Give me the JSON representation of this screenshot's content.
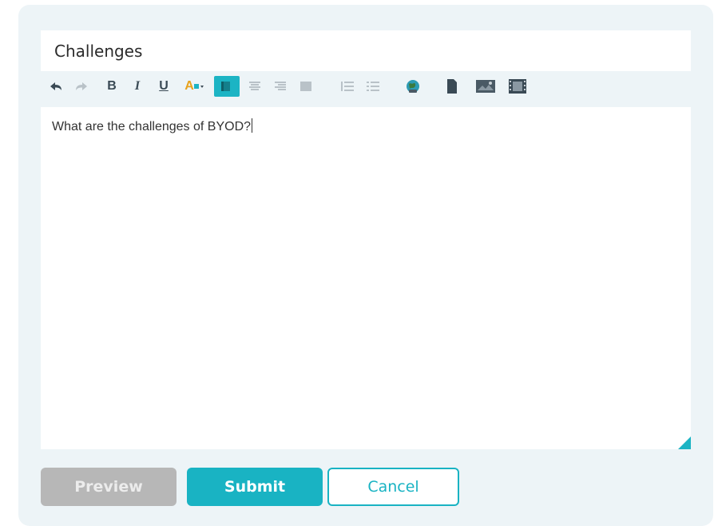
{
  "title_field": {
    "value": "Challenges"
  },
  "toolbar": {
    "items": [
      {
        "name": "undo-icon"
      },
      {
        "name": "redo-icon"
      },
      {
        "name": "bold-icon",
        "glyph": "B"
      },
      {
        "name": "italic-icon",
        "glyph": "I"
      },
      {
        "name": "underline-icon",
        "glyph": "U"
      },
      {
        "name": "font-color-icon",
        "glyph": "A"
      },
      {
        "name": "align-left-icon",
        "active": true
      },
      {
        "name": "align-center-icon"
      },
      {
        "name": "align-right-icon"
      },
      {
        "name": "align-justify-icon"
      },
      {
        "name": "ordered-list-icon"
      },
      {
        "name": "unordered-list-icon"
      },
      {
        "name": "link-icon"
      },
      {
        "name": "file-icon"
      },
      {
        "name": "image-icon"
      },
      {
        "name": "video-icon"
      }
    ],
    "accent_color": "#1cb4c4"
  },
  "editor": {
    "body_text": "What are the challenges of BYOD?"
  },
  "buttons": {
    "preview_label": "Preview",
    "submit_label": "Submit",
    "cancel_label": "Cancel"
  },
  "colors": {
    "panel_bg": "#edf4f7",
    "accent": "#19b3c3",
    "disabled_bg": "#b7b7b7"
  }
}
